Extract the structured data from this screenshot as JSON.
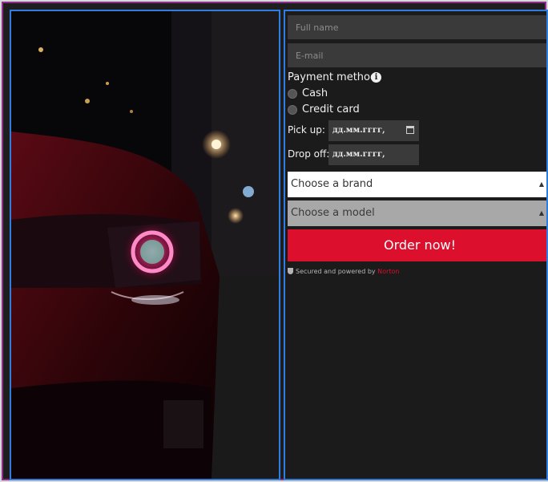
{
  "form": {
    "full_name_placeholder": "Full name",
    "email_placeholder": "E-mail",
    "payment_label": "Payment method:",
    "payment_info_icon": "info-icon",
    "payment_options": [
      "Cash",
      "Credit card"
    ],
    "pickup_label": "Pick up:",
    "pickup_value": "дд.мм.гггг,",
    "dropoff_label": "Drop off:",
    "dropoff_value": "дд.мм.гггг,",
    "brand_select": "Choose a brand",
    "model_select": "Choose a model",
    "order_button": "Order now!",
    "secured_text": "Secured and powered by",
    "secured_brand": "Norton"
  },
  "colors": {
    "accent": "#dc0f2d",
    "panel_border": "#2f7de1",
    "outer_border": "#8a2f8a"
  }
}
